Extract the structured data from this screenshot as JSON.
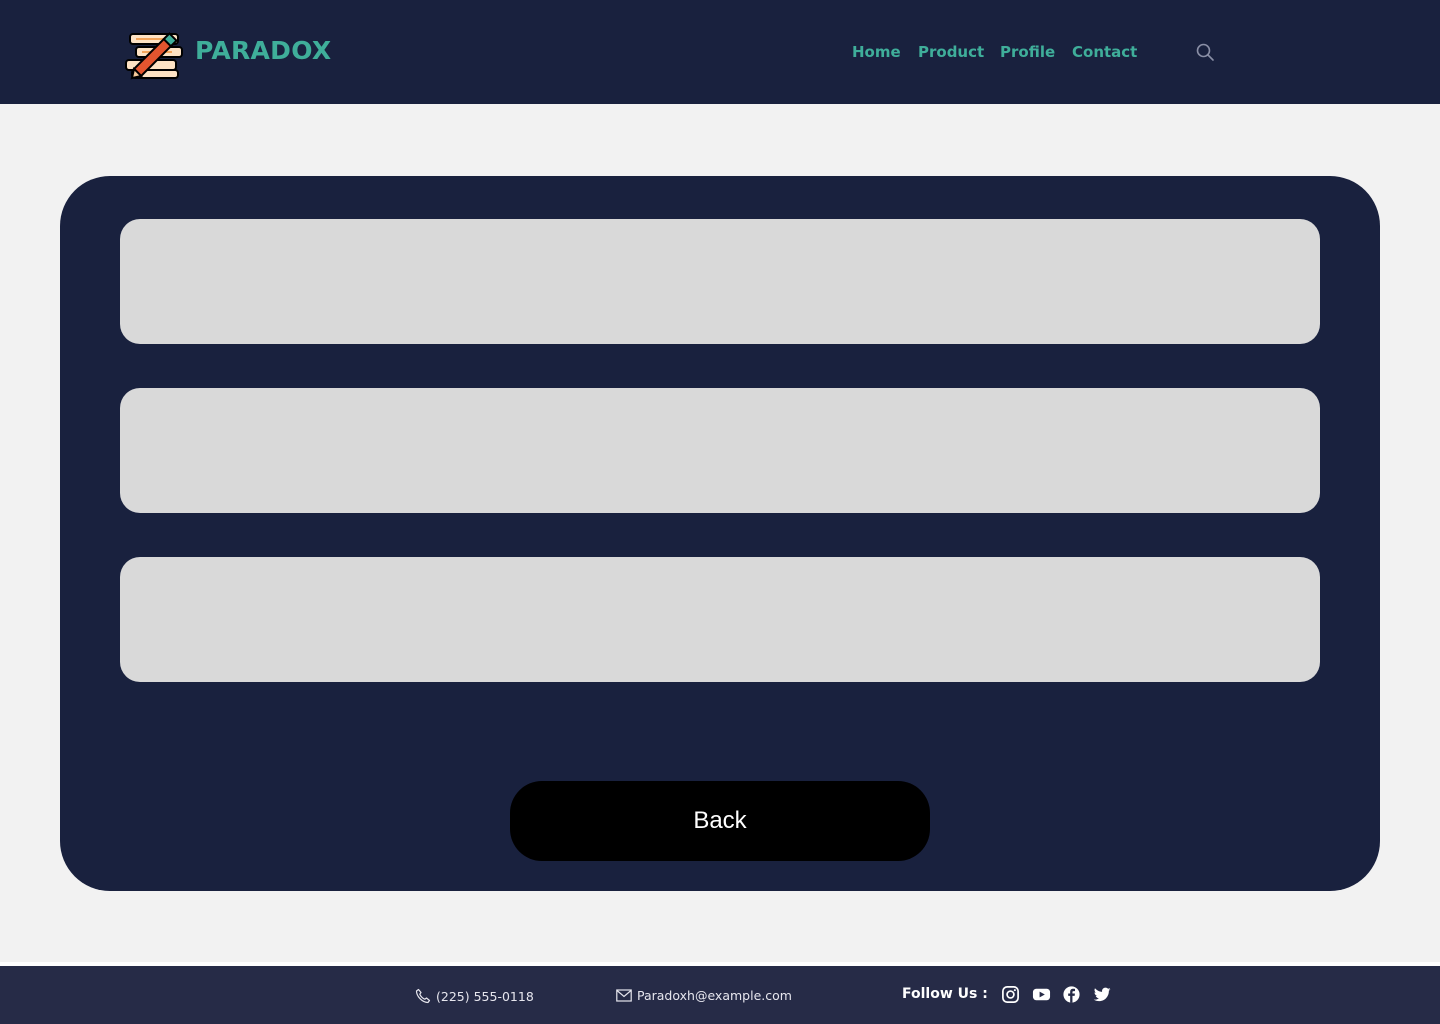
{
  "header": {
    "brand": "PARADOX",
    "nav": [
      {
        "label": "Home"
      },
      {
        "label": "Product"
      },
      {
        "label": "Profile"
      },
      {
        "label": "Contact"
      }
    ],
    "search_icon": "search-icon"
  },
  "main": {
    "fields": [
      {
        "value": ""
      },
      {
        "value": ""
      },
      {
        "value": ""
      }
    ],
    "back_label": "Back"
  },
  "footer": {
    "phone": "(225) 555-0118",
    "email": "Paradoxh@example.com",
    "follow_label": "Follow Us :",
    "social_icons": [
      "instagram-icon",
      "youtube-icon",
      "facebook-icon",
      "twitter-icon"
    ]
  },
  "colors": {
    "navy": "#19213e",
    "footer_navy": "#262b47",
    "accent": "#3fae9a",
    "field_gray": "#d9d9d9",
    "page_bg": "#f2f2f2"
  }
}
